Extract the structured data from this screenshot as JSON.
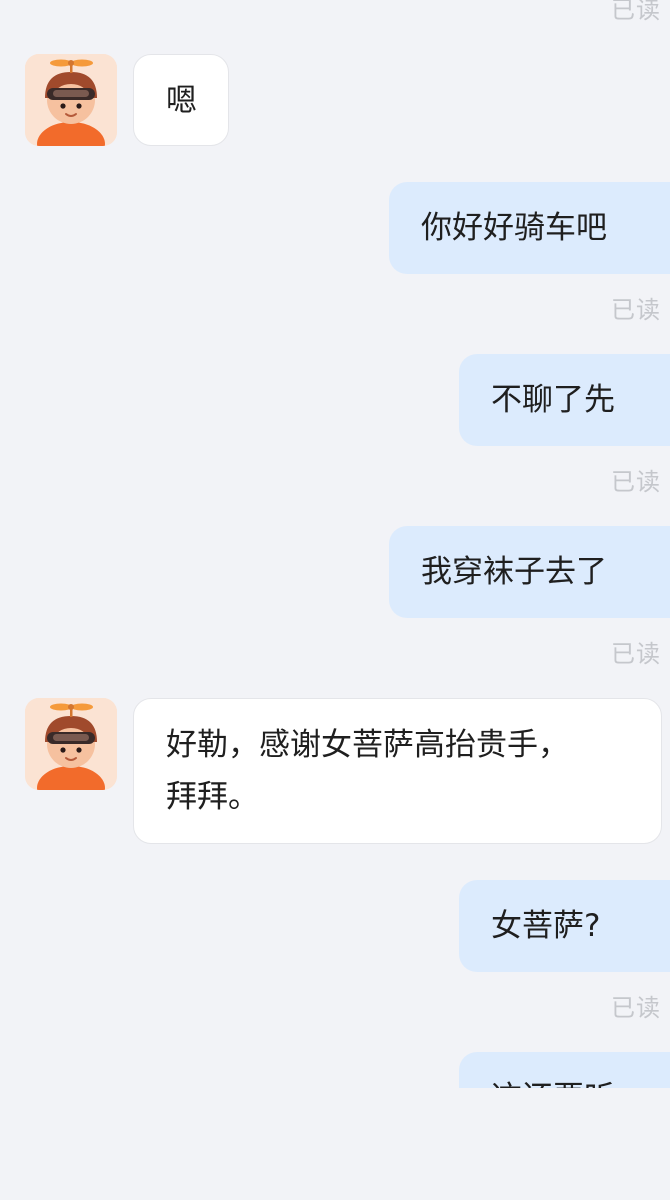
{
  "read_label": "已读",
  "contact": {
    "avatar_icon": "propeller-cap-boy-avatar-icon"
  },
  "messages": [
    {
      "from": "them",
      "text": "嗯"
    },
    {
      "from": "me",
      "text": "你好好骑车吧",
      "status": "已读"
    },
    {
      "from": "me",
      "text": "不聊了先",
      "status": "已读"
    },
    {
      "from": "me",
      "text": "我穿袜子去了",
      "status": "已读"
    },
    {
      "from": "them",
      "lines": [
        "好勒，感谢女菩萨高抬贵手，",
        "拜拜。"
      ]
    },
    {
      "from": "me",
      "text": "女菩萨?",
      "status": "已读"
    },
    {
      "from": "me",
      "text": "这还要听"
    }
  ],
  "colors": {
    "background": "#f2f3f7",
    "outgoing_bubble": "#dcebfd",
    "incoming_bubble": "#ffffff",
    "read_text": "#c5c7cc"
  }
}
